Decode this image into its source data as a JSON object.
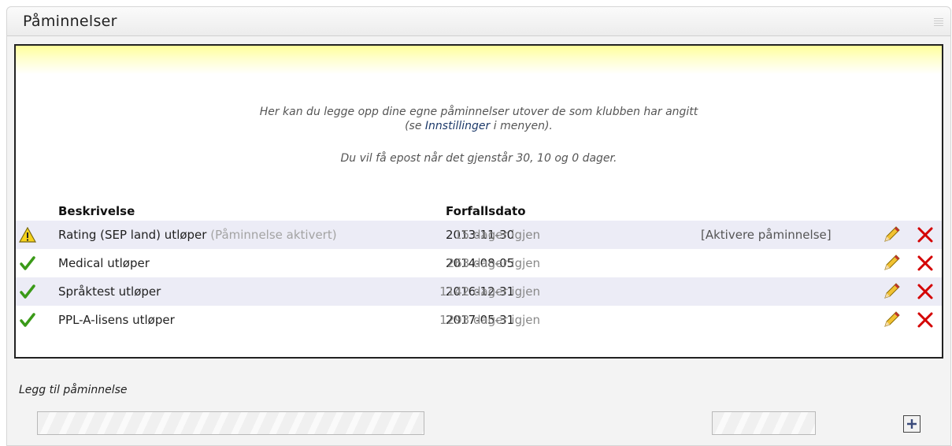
{
  "panel": {
    "title": "Påminnelser"
  },
  "info": {
    "line1": "Her kan du legge opp dine egne påminnelser utover de som klubben har angitt",
    "line2_open": "(se ",
    "line2_link": "Innstillinger",
    "line2_close": " i menyen).",
    "line3": "Du vil få epost når det gjenstår 30, 10 og 0 dager."
  },
  "table": {
    "headers": {
      "description": "Beskrivelse",
      "due_date": "Forfallsdato"
    },
    "rows": [
      {
        "status_icon": "warning-icon",
        "description": "Rating (SEP land) utløper",
        "note": "(Påminnelse aktivert)",
        "date": "2013-11-30",
        "days": "15 dager igjen",
        "action": "[Aktivere påminnelse]"
      },
      {
        "status_icon": "checkmark-icon",
        "description": "Medical utløper",
        "note": "",
        "date": "2014-08-05",
        "days": "263 dager igjen",
        "action": ""
      },
      {
        "status_icon": "checkmark-icon",
        "description": "Språktest utløper",
        "note": "",
        "date": "2016-12-31",
        "days": "1142 dager igjen",
        "action": ""
      },
      {
        "status_icon": "checkmark-icon",
        "description": "PPL-A-lisens utløper",
        "note": "",
        "date": "2017-05-31",
        "days": "1293 dager igjen",
        "action": ""
      }
    ]
  },
  "add": {
    "label": "Legg til påminnelse",
    "description_value": "",
    "date_value": ""
  },
  "colors": {
    "delete": "#d40000",
    "warning": "#f2c200",
    "check": "#3a9a18",
    "row_shade": "#ececf6"
  }
}
